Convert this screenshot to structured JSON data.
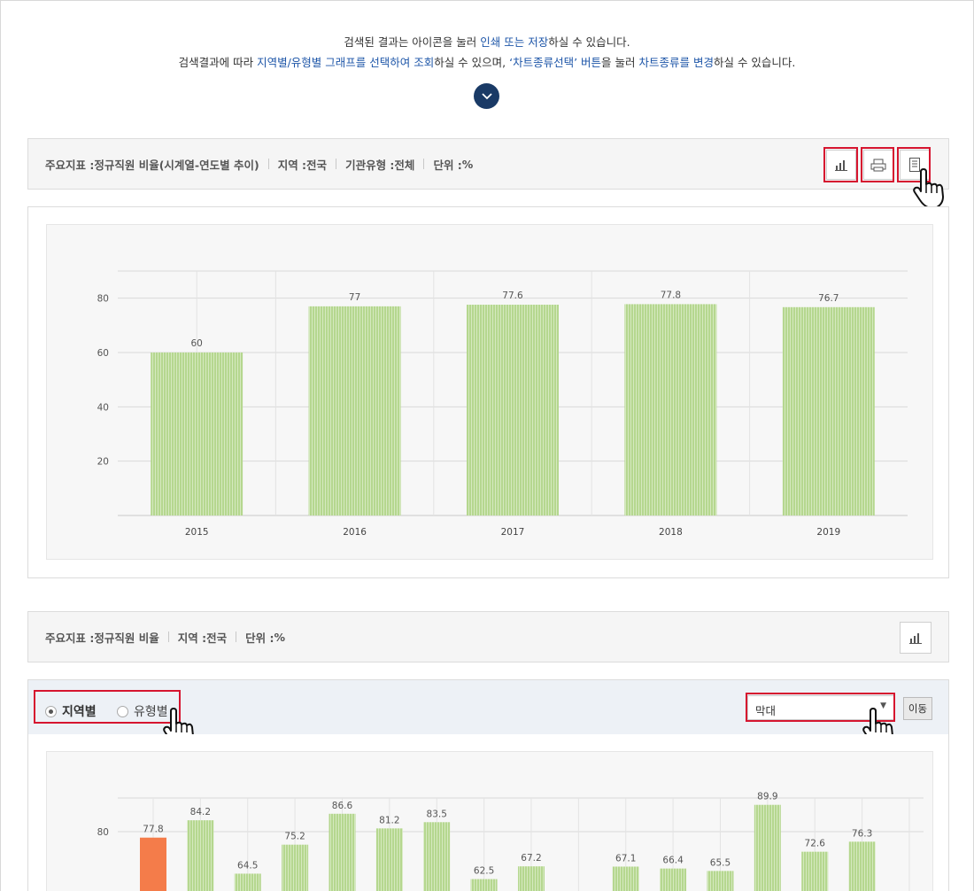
{
  "intro": {
    "line1_a": "검색된 결과는 아이콘을 눌러 ",
    "line1_b": "인쇄 또는 저장",
    "line1_c": "하실 수 있습니다.",
    "line2_a": "검색결과에 따라 ",
    "line2_b": "지역별/유형별 그래프를 선택하여 조회",
    "line2_c": "하실 수 있으며, ",
    "line2_d": "‘차트종류선택’ 버튼",
    "line2_e": "을 눌러 ",
    "line2_f": "차트종류를 변경",
    "line2_g": "하실 수 있습니다."
  },
  "panel1": {
    "indicator_label": "주요지표 : ",
    "indicator_value": "정규직원 비율(시계열-연도별 추이)",
    "region_label": "지역 : ",
    "region_value": "전국",
    "type_label": "기관유형 : ",
    "type_value": "전체",
    "unit_label": "단위 : ",
    "unit_value": "%"
  },
  "panel2": {
    "indicator_label": "주요지표 : ",
    "indicator_value": "정규직원 비율",
    "region_label": "지역 : ",
    "region_value": "전국",
    "unit_label": "단위 : ",
    "unit_value": "%"
  },
  "filter": {
    "radio_region": "지역별",
    "radio_type": "유형별",
    "chart_type_selected": "막대",
    "move_label": "이동"
  },
  "icons": {
    "chart_select": "bar-chart-icon",
    "print": "printer-icon",
    "save": "document-icon",
    "expand": "chevron-down-icon",
    "pointer": "hand-pointer-icon"
  },
  "colors": {
    "bar": "#b5d78f",
    "bar_highlight": "#f47c4a",
    "accent_blue": "#1e56a8",
    "navy": "#1a3a66",
    "red_box": "#d6152f"
  },
  "chart_data": [
    {
      "type": "bar",
      "categories": [
        "2015",
        "2016",
        "2017",
        "2018",
        "2019"
      ],
      "values": [
        60,
        77,
        77.6,
        77.8,
        76.7
      ],
      "yticks": [
        20,
        40,
        60,
        80
      ],
      "ylim": [
        0,
        90
      ]
    },
    {
      "type": "bar",
      "values": [
        77.8,
        84.2,
        64.5,
        75.2,
        86.6,
        81.2,
        83.5,
        62.5,
        67.2,
        null,
        67.1,
        66.4,
        65.5,
        89.9,
        72.6,
        76.3
      ],
      "highlight_index": 0,
      "yticks": [
        80
      ],
      "ylim": [
        0,
        100
      ]
    }
  ]
}
